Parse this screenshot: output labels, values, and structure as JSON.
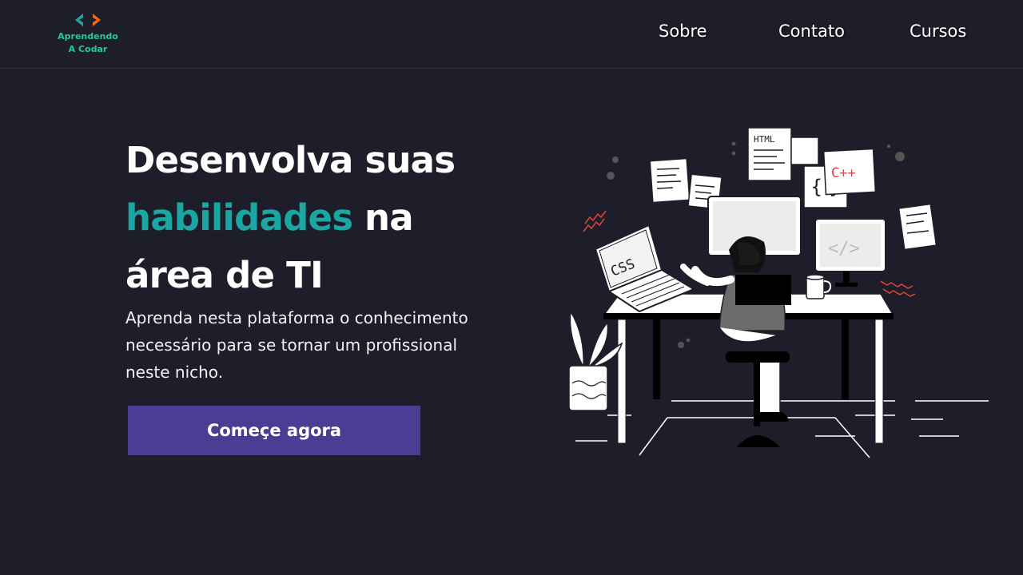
{
  "header": {
    "logo": {
      "line1": "Aprendendo",
      "line2": "A Codar",
      "icon_left": "chevron-left-icon",
      "icon_right": "chevron-right-icon",
      "colors": {
        "left": "#1aa6a2",
        "right": "#f06a1c",
        "text": "#22c9a0"
      }
    },
    "nav": [
      "Sobre",
      "Contato",
      "Cursos"
    ]
  },
  "hero": {
    "title_line1": "Desenvolva suas",
    "title_accent": "habilidades",
    "title_line2_rest": " na",
    "title_line3": "área de TI",
    "subtitle": "Aprenda nesta plataforma o conhecimento necessário para se tornar um profissional neste nicho.",
    "cta_label": "Começe agora",
    "accent_color": "#1aa6a2",
    "cta_color": "#4a3d94"
  },
  "illustration": {
    "laptop_text": "CSS",
    "doc1_text": "HTML",
    "doc2_text": "C++",
    "monitor_text": "</>"
  }
}
